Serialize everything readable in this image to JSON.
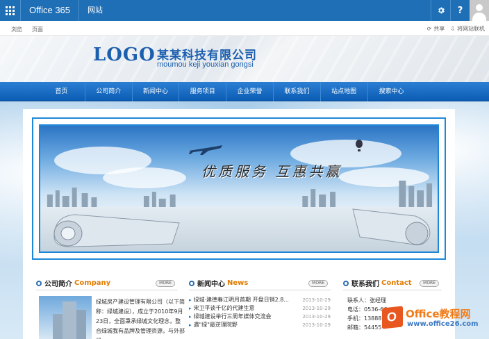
{
  "suitebar": {
    "brand": "Office 365",
    "site_link": "网站",
    "settings_icon": "gear-icon",
    "help_label": "?"
  },
  "ribbon": {
    "tabs": [
      "浏览",
      "页面"
    ],
    "share": "共享",
    "sync": "将网站联机"
  },
  "header": {
    "logo": "LOGO",
    "company_cn": "某某科技有限公司",
    "company_en": "moumou keji youxian gongsi"
  },
  "nav": {
    "items": [
      "首页",
      "公司简介",
      "新闻中心",
      "服务项目",
      "企业荣誉",
      "联系我们",
      "站点地图",
      "搜索中心"
    ]
  },
  "banner": {
    "slogan": "优质服务 互惠共赢"
  },
  "about": {
    "title": "公司简介",
    "title_en": "Company",
    "more": "MORE",
    "text": "绿城房产建设管理有限公司（以下简称：绿城建设），成立于2010年9月23日，全面秉承绿城文化理念，整合绿城我有品牌及管理资源，与外部机"
  },
  "news": {
    "title": "新闻中心",
    "title_en": "News",
    "more": "MORE",
    "items": [
      {
        "title": "绿城·建德春江明月首期 开盘日销2.8...",
        "date": "2013-10-29"
      },
      {
        "title": "宋卫平谈千亿的代建生意",
        "date": "2013-10-29"
      },
      {
        "title": "绿城建设举行三周年媒体交流会",
        "date": "2013-10-29"
      },
      {
        "title": "遇\"绿\"最逆理院野",
        "date": "2013-10-29"
      }
    ]
  },
  "contact": {
    "title": "联系我们",
    "title_en": "Contact",
    "more": "MORE",
    "items": [
      "联系人：张经理",
      "电话：0536-66",
      "手机：138888",
      "邮箱：54455"
    ]
  },
  "watermark": {
    "title": "Office教程网",
    "url": "www.office26.com"
  }
}
